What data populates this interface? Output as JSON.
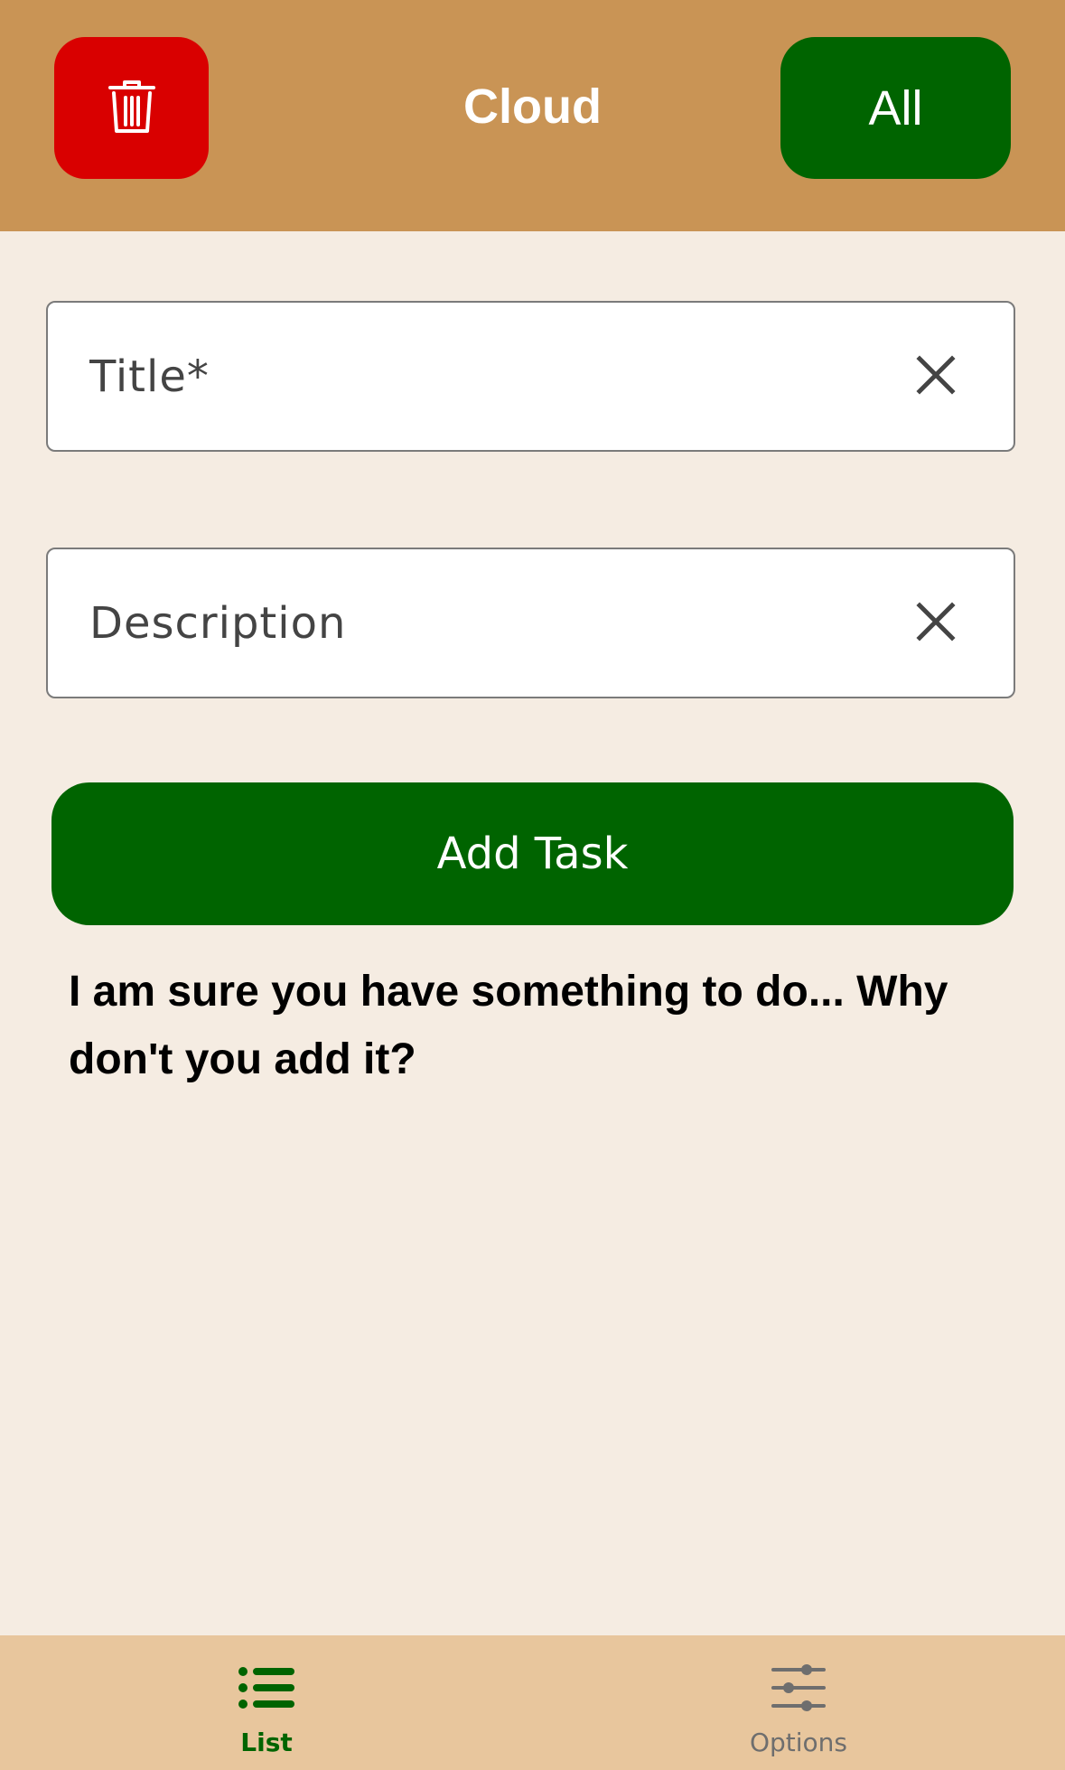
{
  "header": {
    "title": "Cloud",
    "filter_label": "All",
    "colors": {
      "bar": "#c99455",
      "delete_button": "#d90000",
      "filter_button": "#006400"
    }
  },
  "form": {
    "title_placeholder": "Title*",
    "title_value": "",
    "description_placeholder": "Description",
    "description_value": "",
    "add_button_label": "Add Task",
    "accent": "#006400"
  },
  "empty_state": {
    "message": "I am sure you have something to do... Why don't you add it?"
  },
  "bottom_nav": {
    "items": [
      {
        "label": "List",
        "icon": "list-icon",
        "active": true
      },
      {
        "label": "Options",
        "icon": "sliders-icon",
        "active": false
      }
    ]
  },
  "icons": {
    "delete": "trash-icon",
    "clear": "close-icon"
  }
}
